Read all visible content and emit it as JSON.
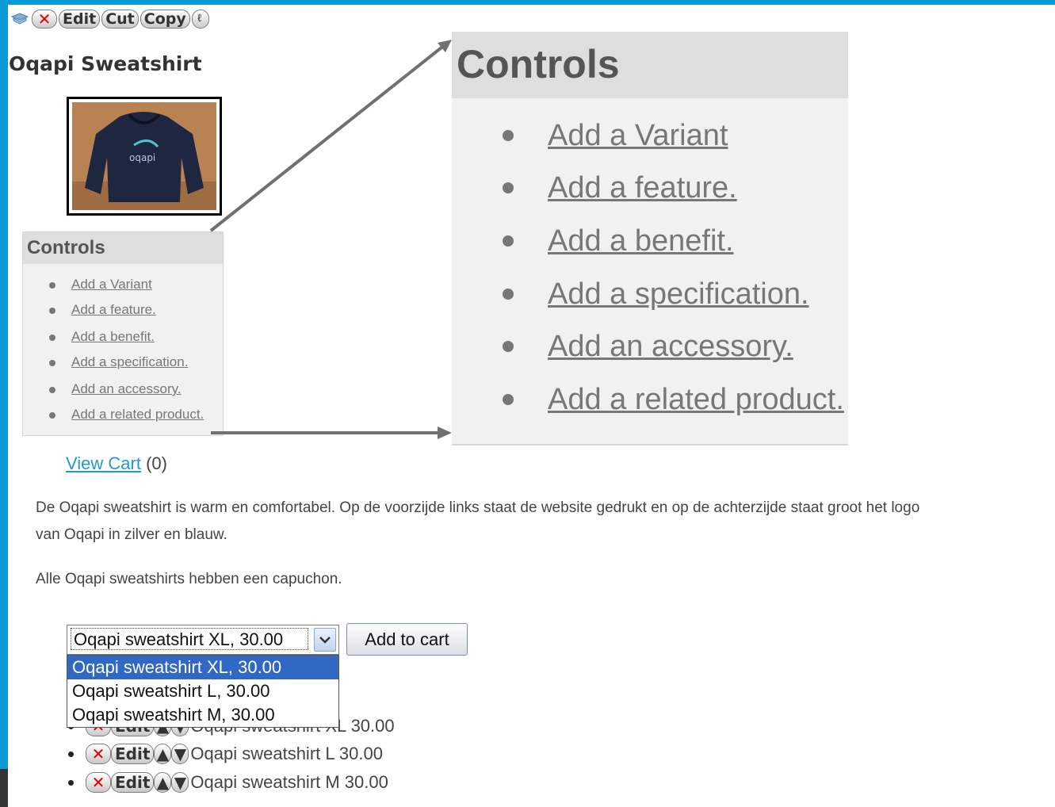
{
  "toolbar": {
    "buttons": [
      {
        "label": "✕",
        "icon": "delete-icon"
      },
      {
        "label": "Edit"
      },
      {
        "label": "Cut"
      },
      {
        "label": "Copy"
      },
      {
        "label": "",
        "icon": "info-icon"
      }
    ]
  },
  "product": {
    "title": "Oqapi Sweatshirt",
    "image_label": "oqapi"
  },
  "controls": {
    "heading": "Controls",
    "items": [
      "Add a Variant",
      "Add a feature.",
      "Add a benefit.",
      "Add a specification.",
      "Add an accessory.",
      "Add a related product."
    ]
  },
  "cart": {
    "link": "View Cart",
    "count": "(0)"
  },
  "description": {
    "line1": "De Oqapi sweatshirt is warm en comfortabel. Op de voorzijde links staat de website gedrukt en op de achterzijde staat groot het logo",
    "line2": "van Oqapi in zilver en blauw.",
    "line3": "Alle Oqapi sweatshirts hebben een capuchon."
  },
  "purchase": {
    "selected": "Oqapi sweatshirt XL, 30.00",
    "options": [
      "Oqapi sweatshirt XL, 30.00",
      "Oqapi sweatshirt L, 30.00",
      "Oqapi sweatshirt M, 30.00"
    ],
    "add_to_cart": "Add to cart"
  },
  "variants": {
    "edit_label": "Edit",
    "delete_label": "✕",
    "items": [
      "Oqapi sweatshirt XL 30.00",
      "Oqapi sweatshirt L 30.00",
      "Oqapi sweatshirt M 30.00"
    ]
  },
  "colors": {
    "frame": "#0a98d6",
    "link": "#2299cc",
    "panel": "#f1f1f1",
    "panel_header": "#dedede",
    "selection": "#3168c4",
    "delete": "#e00000"
  }
}
